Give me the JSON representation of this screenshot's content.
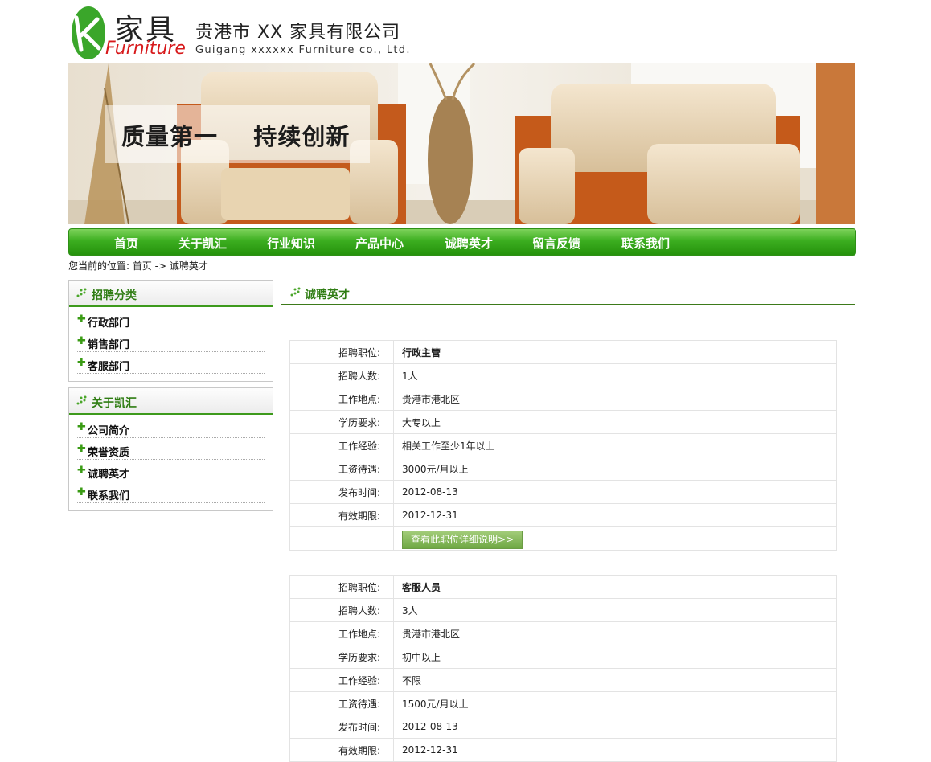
{
  "header": {
    "logo_cn": "家具",
    "logo_en": "Furniture",
    "company_cn": "贵港市 XX 家具有限公司",
    "company_en": "Guigang xxxxxx Furniture co., Ltd."
  },
  "banner": {
    "slogan": "质量第一    持续创新"
  },
  "nav": [
    "首页",
    "关于凯汇",
    "行业知识",
    "产品中心",
    "诚聘英才",
    "留言反馈",
    "联系我们"
  ],
  "breadcrumb": "您当前的位置: 首页 -> 诚聘英才",
  "sidebar": {
    "recruit": {
      "title": "招聘分类",
      "items": [
        "行政部门",
        "销售部门",
        "客服部门"
      ]
    },
    "about": {
      "title": "关于凯汇",
      "items": [
        "公司简介",
        "荣誉资质",
        "诚聘英才",
        "联系我们"
      ]
    }
  },
  "main": {
    "title": "诚聘英才",
    "labels": [
      "招聘职位:",
      "招聘人数:",
      "工作地点:",
      "学历要求:",
      "工作经验:",
      "工资待遇:",
      "发布时间:",
      "有效期限:"
    ],
    "detail_button": "查看此职位详细说明>>",
    "jobs": [
      {
        "position": "行政主管",
        "count": "1人",
        "location": "贵港市港北区",
        "education": "大专以上",
        "experience": "相关工作至少1年以上",
        "salary": "3000元/月以上",
        "published": "2012-08-13",
        "expires": "2012-12-31"
      },
      {
        "position": "客服人员",
        "count": "3人",
        "location": "贵港市港北区",
        "education": "初中以上",
        "experience": "不限",
        "salary": "1500元/月以上",
        "published": "2012-08-13",
        "expires": "2012-12-31"
      }
    ]
  },
  "colors": {
    "brand_green": "#3cae20",
    "heading_green": "#2f7d13",
    "logo_red": "#d7191b"
  }
}
